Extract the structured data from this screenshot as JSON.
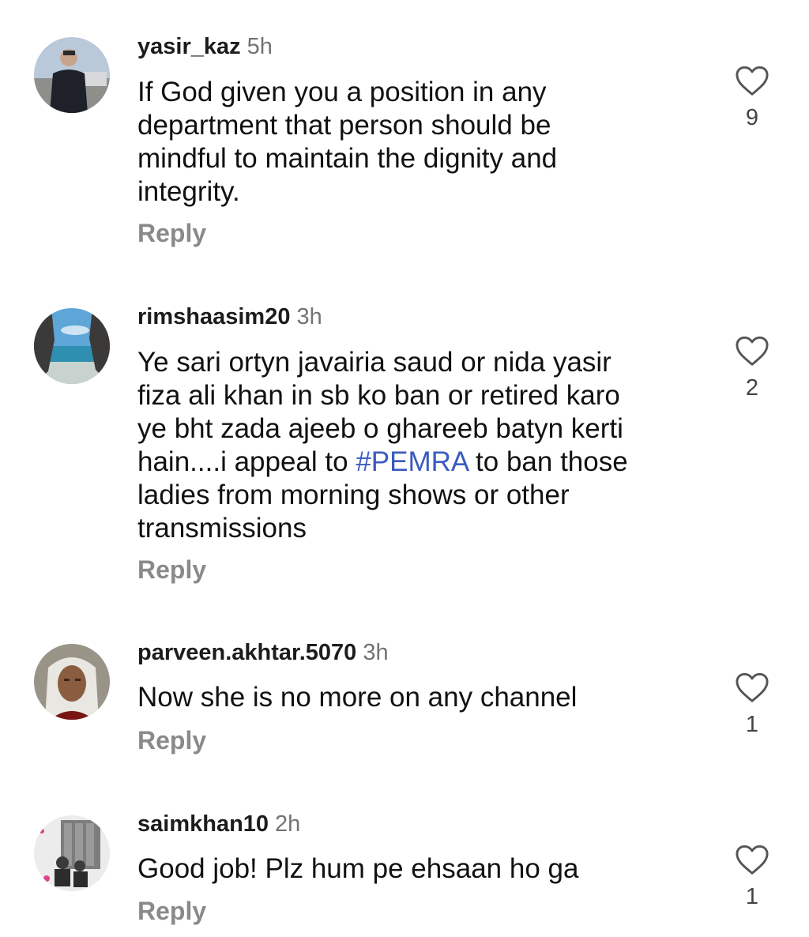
{
  "comments": [
    {
      "username": "yasir_kaz",
      "time": "5h",
      "lines": [
        "If God given you a position in any",
        "department that person should be",
        "mindful to maintain the dignity and",
        "integrity."
      ],
      "likes": "9",
      "reply_label": "Reply",
      "icon": "heart-outline-icon"
    },
    {
      "username": "rimshaasim20",
      "time": "3h",
      "lines": [
        "Ye sari ortyn javairia saud or nida yasir",
        "fiza ali khan in sb ko ban or retired karo",
        "ye bht zada ajeeb o ghareeb batyn kerti"
      ],
      "line4_before": "hain....i appeal to ",
      "hashtag": "#PEMRA",
      "line4_after": " to ban those",
      "lines_after": [
        "ladies from morning shows or other",
        "transmissions"
      ],
      "likes": "2",
      "reply_label": "Reply",
      "icon": "heart-outline-icon"
    },
    {
      "username": "parveen.akhtar.5070",
      "time": "3h",
      "lines": [
        "Now she is no more on any channel"
      ],
      "likes": "1",
      "reply_label": "Reply",
      "icon": "heart-outline-icon"
    },
    {
      "username": "saimkhan10",
      "time": "2h",
      "lines": [
        "Good job! Plz hum pe ehsaan ho ga"
      ],
      "likes": "1",
      "reply_label": "Reply",
      "icon": "heart-outline-icon"
    }
  ],
  "colors": {
    "hashtag": "#3a5bbf",
    "meta": "#737373",
    "reply": "#8a8a8a"
  }
}
